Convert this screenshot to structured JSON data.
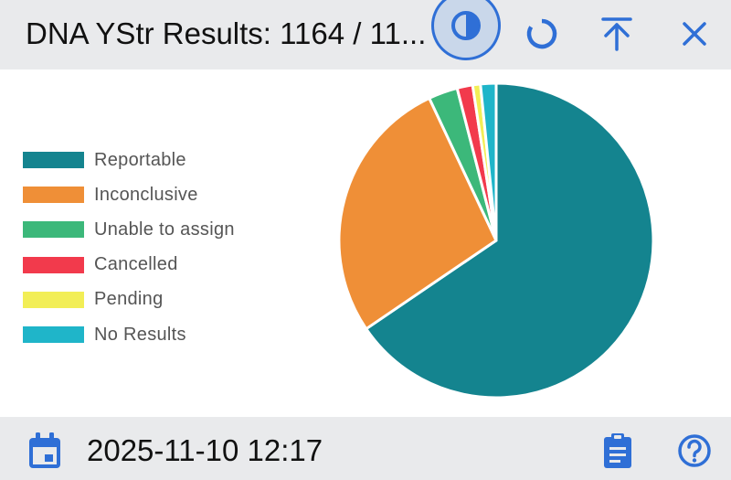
{
  "header": {
    "title": "DNA YStr Results: 1164 / 11...",
    "buttons": {
      "contrast": "contrast-icon",
      "refresh": "refresh-icon",
      "scroll_top": "arrow-up-to-line-icon",
      "close": "close-icon"
    }
  },
  "colors": {
    "header_bg": "#e9eaec",
    "accent": "#2f6fd6",
    "active_button_bg": "#c9d7ea"
  },
  "chart_data": {
    "type": "pie",
    "legend_position": "left",
    "series": [
      {
        "label": "Reportable",
        "value": 65.5,
        "color": "#14848f"
      },
      {
        "label": "Inconclusive",
        "value": 27.5,
        "color": "#ef8f37"
      },
      {
        "label": "Unable to assign",
        "value": 3.0,
        "color": "#3cb87a"
      },
      {
        "label": "Cancelled",
        "value": 1.6,
        "color": "#f23a4c"
      },
      {
        "label": "Pending",
        "value": 0.8,
        "color": "#f2ee56"
      },
      {
        "label": "No Results",
        "value": 1.6,
        "color": "#1fb5c9"
      }
    ]
  },
  "footer": {
    "datetime": "2025-11-10 12:17",
    "icons": {
      "calendar": "calendar-icon",
      "clipboard": "clipboard-icon",
      "help": "help-icon"
    }
  }
}
